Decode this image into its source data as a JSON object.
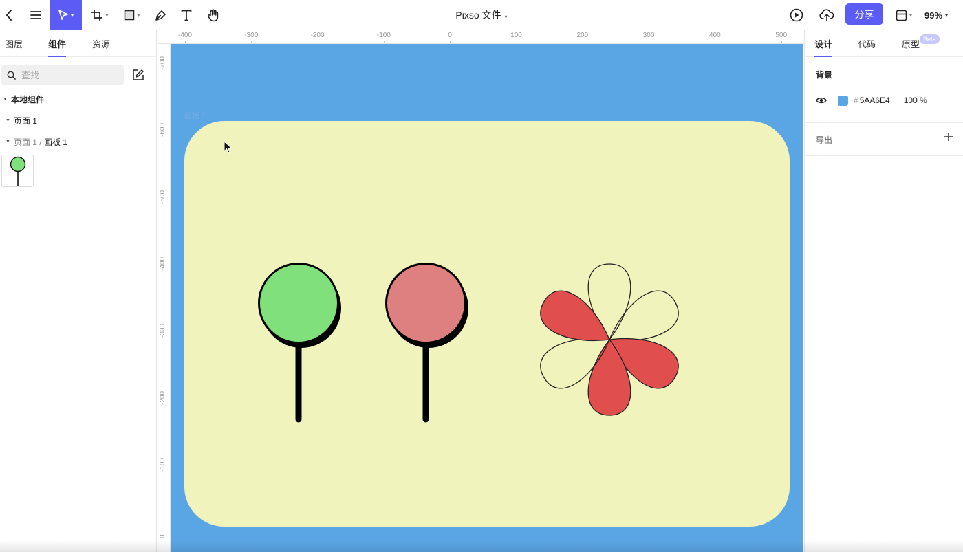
{
  "toolbar": {
    "document_title": "Pixso 文件",
    "share_label": "分享",
    "zoom": "99%",
    "icons": [
      "back-icon",
      "menu-icon",
      "move-tool-icon",
      "frame-tool-icon",
      "rectangle-tool-icon",
      "pen-tool-icon",
      "text-tool-icon",
      "hand-tool-icon",
      "play-icon",
      "upload-cloud-icon",
      "layout-icon"
    ]
  },
  "left_panel": {
    "tabs": [
      {
        "label": "图层",
        "active": false
      },
      {
        "label": "组件",
        "active": true
      },
      {
        "label": "资源",
        "active": false
      }
    ],
    "search": {
      "placeholder": "查找"
    },
    "section_title": "本地组件",
    "page_item": "页面 1",
    "breadcrumb": {
      "page": "页面 1 /",
      "frame": "画板 1"
    }
  },
  "ruler": {
    "x_labels": [
      "-400",
      "-300",
      "-200",
      "-100",
      "0",
      "100",
      "200",
      "300",
      "400",
      "500"
    ],
    "y_labels": [
      "-700",
      "-600",
      "-500",
      "-400",
      "-300",
      "-200",
      "-100",
      "0"
    ]
  },
  "canvas": {
    "background_color": "#5AA6E4",
    "artboard_color": "#F1F3BC",
    "frame_label": "画板 1",
    "shapes": {
      "lollipop_green_color": "#7FE07C",
      "lollipop_red_color": "#DE807F",
      "flower_fill_color": "#E04E4E"
    }
  },
  "right_panel": {
    "tabs": [
      {
        "label": "设计",
        "active": true
      },
      {
        "label": "代码",
        "active": false
      },
      {
        "label": "原型",
        "active": false
      }
    ],
    "beta_badge": "Beta",
    "background": {
      "title": "背景",
      "hash": "#",
      "hex": "5AA6E4",
      "opacity": "100 %"
    },
    "export": {
      "title": "导出"
    }
  }
}
